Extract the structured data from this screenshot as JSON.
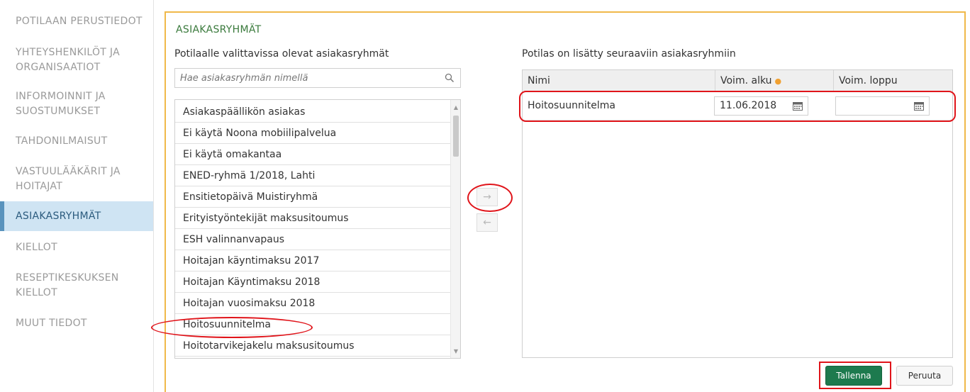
{
  "sidebar": {
    "items": [
      {
        "label_lines": [
          "POTILAAN PERUSTIEDOT"
        ]
      },
      {
        "label_lines": [
          "YHTEYSHENKILÖT JA",
          "ORGANISAATIOT"
        ]
      },
      {
        "label_lines": [
          "INFORMOINNIT JA",
          "SUOSTUMUKSET"
        ]
      },
      {
        "label_lines": [
          "TAHDONILMAISUT"
        ]
      },
      {
        "label_lines": [
          "VASTUULÄÄKÄRIT JA",
          "HOITAJAT"
        ]
      },
      {
        "label_lines": [
          "ASIAKASRYHMÄT"
        ]
      },
      {
        "label_lines": [
          "KIELLOT"
        ]
      },
      {
        "label_lines": [
          "RESEPTIKESKUKSEN",
          "KIELLOT"
        ]
      },
      {
        "label_lines": [
          "MUUT TIEDOT"
        ]
      }
    ],
    "active_index": 5
  },
  "panel": {
    "title": "ASIAKASRYHMÄT",
    "available_label": "Potilaalle valittavissa olevat asiakasryhmät",
    "selected_label": "Potilas on lisätty seuraaviin asiakasryhmiin"
  },
  "search": {
    "placeholder": "Hae asiakasryhmän nimellä",
    "value": ""
  },
  "available_groups": [
    "Asiakaspäällikön asiakas",
    "Ei käytä Noona mobiilipalvelua",
    "Ei käytä omakantaa",
    "ENED-ryhmä 1/2018, Lahti",
    "Ensitietopäivä Muistiryhmä",
    "Erityistyöntekijät maksusitoumus",
    "ESH valinnanvapaus",
    "Hoitajan käyntimaksu 2017",
    "Hoitajan Käyntimaksu 2018",
    "Hoitajan vuosimaksu 2018",
    "Hoitosuunnitelma",
    "Hoitotarvikejakelu maksusitoumus"
  ],
  "transfer": {
    "add_glyph": "→",
    "remove_glyph": "←"
  },
  "selected_table": {
    "columns": {
      "name": "Nimi",
      "start": "Voim. alku",
      "end": "Voim. loppu"
    },
    "rows": [
      {
        "name": "Hoitosuunnitelma",
        "start": "11.06.2018",
        "end": ""
      }
    ]
  },
  "buttons": {
    "save": "Tallenna",
    "cancel": "Peruuta"
  },
  "colors": {
    "accent_green": "#1d7a4e",
    "panel_border": "#f0b94a",
    "annotation_red": "#e0141a",
    "required_dot": "#f0a030"
  },
  "icons": {
    "search": "magnifier-icon",
    "calendar": "calendar-icon"
  }
}
